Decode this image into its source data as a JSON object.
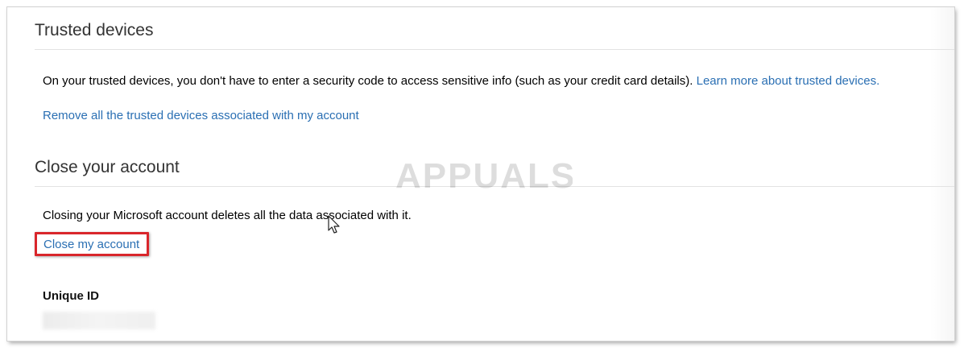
{
  "trusted_devices": {
    "title": "Trusted devices",
    "description": "On your trusted devices, you don't have to enter a security code to access sensitive info (such as your credit card details).",
    "learn_more_link": "Learn more about trusted devices.",
    "remove_link": "Remove all the trusted devices associated with my account"
  },
  "close_account": {
    "title": "Close your account",
    "description": "Closing your Microsoft account deletes all the data associated with it.",
    "close_link": "Close my account"
  },
  "unique_id": {
    "label": "Unique ID"
  },
  "watermark": {
    "text": "APPUALS"
  },
  "colors": {
    "link": "#2a6fb3",
    "highlight": "#d9262b",
    "text": "#000000",
    "heading": "#333333"
  },
  "icons": [
    "mouse-pointer-icon",
    "appuals-logo-icon"
  ]
}
